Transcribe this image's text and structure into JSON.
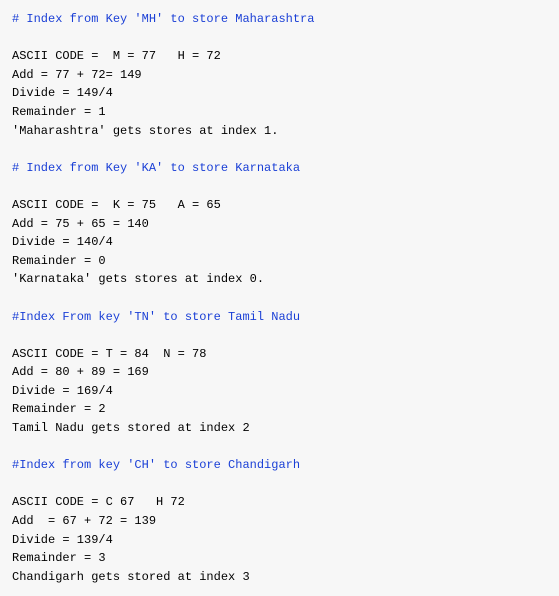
{
  "sections": [
    {
      "comment": "# Index from Key 'MH' to store Maharashtra",
      "lines": [
        "ASCII CODE =  M = 77   H = 72",
        "Add = 77 + 72= 149",
        "Divide = 149/4",
        "Remainder = 1",
        "'Maharashtra' gets stores at index 1."
      ]
    },
    {
      "comment": "# Index from Key 'KA' to store Karnataka",
      "lines": [
        "ASCII CODE =  K = 75   A = 65",
        "Add = 75 + 65 = 140",
        "Divide = 140/4",
        "Remainder = 0",
        "'Karnataka' gets stores at index 0."
      ]
    },
    {
      "comment": "#Index From key 'TN' to store Tamil Nadu",
      "lines": [
        "ASCII CODE = T = 84  N = 78",
        "Add = 80 + 89 = 169",
        "Divide = 169/4",
        "Remainder = 2",
        "Tamil Nadu gets stored at index 2"
      ]
    },
    {
      "comment": "#Index from key 'CH' to store Chandigarh",
      "lines": [
        "ASCII CODE = C 67   H 72",
        "Add  = 67 + 72 = 139",
        "Divide = 139/4",
        "Remainder = 3",
        "Chandigarh gets stored at index 3"
      ]
    }
  ]
}
